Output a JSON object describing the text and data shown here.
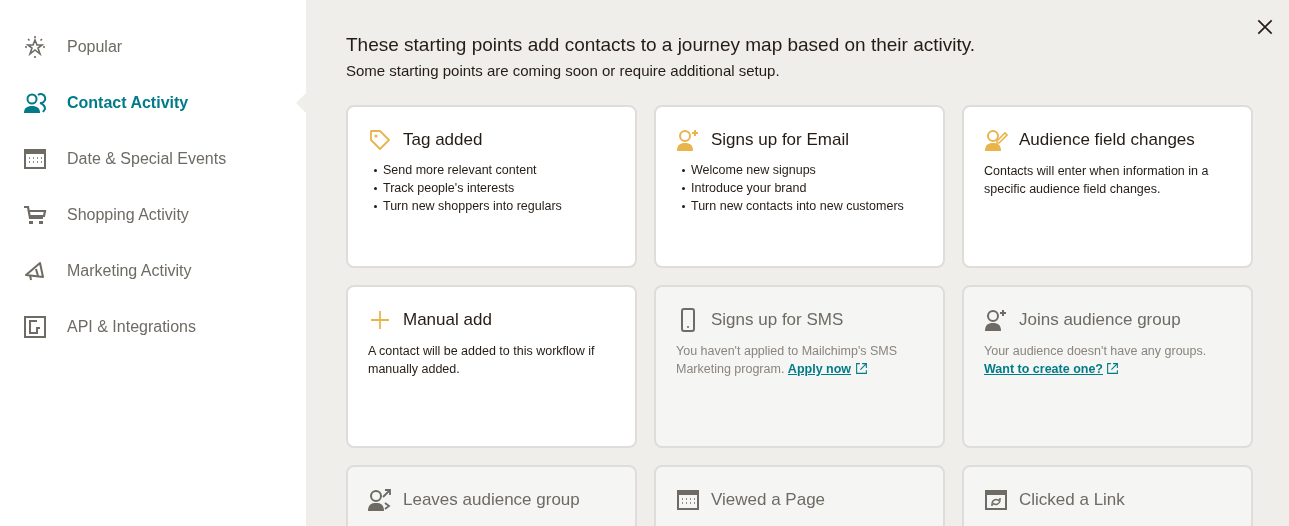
{
  "sidebar": {
    "items": [
      {
        "label": "Popular",
        "selected": false
      },
      {
        "label": "Contact Activity",
        "selected": true
      },
      {
        "label": "Date & Special Events",
        "selected": false
      },
      {
        "label": "Shopping Activity",
        "selected": false
      },
      {
        "label": "Marketing Activity",
        "selected": false
      },
      {
        "label": "API & Integrations",
        "selected": false
      }
    ]
  },
  "heading": "These starting points add contacts to a journey map based on their activity.",
  "subheading": "Some starting points are coming soon or require additional setup.",
  "cards": [
    {
      "title": "Tag added",
      "disabled": false,
      "bullets": [
        "Send more relevant content",
        "Track people's interests",
        "Turn new shoppers into regulars"
      ]
    },
    {
      "title": "Signs up for Email",
      "disabled": false,
      "bullets": [
        "Welcome new signups",
        "Introduce your brand",
        "Turn new contacts into new customers"
      ]
    },
    {
      "title": "Audience field changes",
      "disabled": false,
      "text": "Contacts will enter when information in a specific audience field changes."
    },
    {
      "title": "Manual add",
      "disabled": false,
      "text": "A contact will be added to this workflow if manually added."
    },
    {
      "title": "Signs up for SMS",
      "disabled": true,
      "text": "You haven't applied to Mailchimp's SMS Marketing program.",
      "link": "Apply now"
    },
    {
      "title": "Joins audience group",
      "disabled": true,
      "text": "Your audience doesn't have any groups.",
      "link": "Want to create one?"
    },
    {
      "title": "Leaves audience group",
      "disabled": true
    },
    {
      "title": "Viewed a Page",
      "disabled": true
    },
    {
      "title": "Clicked a Link",
      "disabled": true
    }
  ]
}
